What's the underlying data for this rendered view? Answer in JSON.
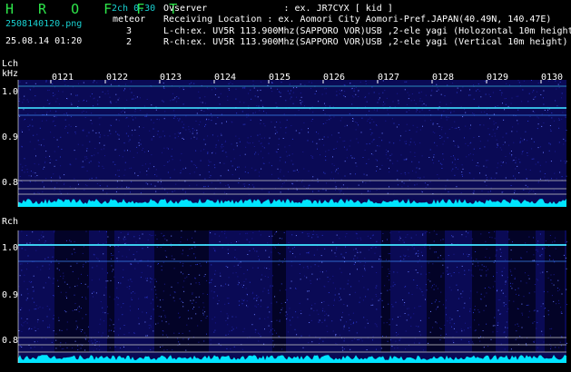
{
  "header": {
    "title": "H R O F F T",
    "version": "2ch 0.30",
    "filename": "2508140120.png",
    "meteor_label": "meteor",
    "lch_count": "3",
    "rch_count": "2",
    "datetime": "25.08.14 01:20",
    "observer": "Ovserver              : ex. JR7CYX [ kid ]",
    "location": "Receiving Location : ex. Aomori City Aomori-Pref.JAPAN(40.49N, 140.47E)",
    "lch_info": "L-ch:ex. UV5R 113.900Mhz(SAPPORO VOR)USB ,2-ele yagi (Holozontal 10m height)",
    "rch_info": "R-ch:ex. UV5R 113.900Mhz(SAPPORO VOR)USB ,2-ele yagi (Vertical 10m height)"
  },
  "lch_panel": {
    "channel_label": "Lch",
    "unit_label": "kHz",
    "ticks": [
      "1.0",
      "0.9",
      "0.8"
    ],
    "minutes": [
      "0121",
      "0122",
      "0123",
      "0124",
      "0125",
      "0126",
      "0127",
      "0128",
      "0129",
      "0130"
    ]
  },
  "rch_panel": {
    "channel_label": "Rch",
    "ticks": [
      "1.0",
      "0.9",
      "0.8"
    ]
  },
  "colors": {
    "title": "#2ee64a",
    "accent_cyan": "#19d1d1",
    "spectrogram_bg": "#0a0a55",
    "signal_line": "#40e0ff",
    "noise_floor": "#00e5ff"
  }
}
